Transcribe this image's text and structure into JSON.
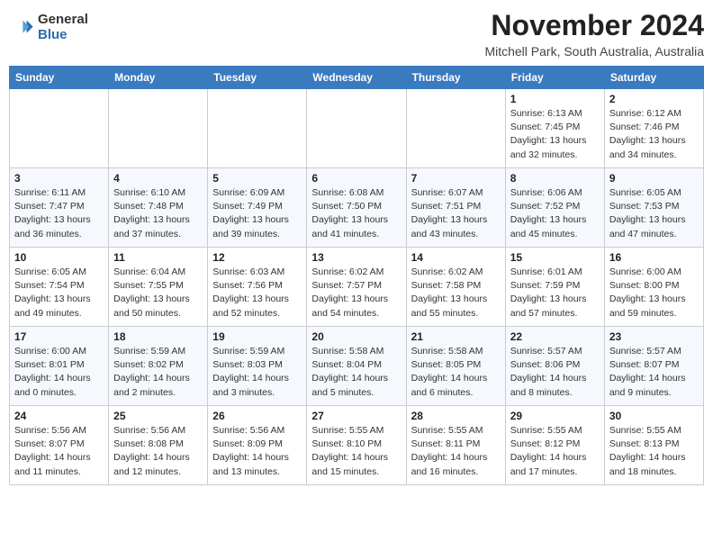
{
  "header": {
    "logo_general": "General",
    "logo_blue": "Blue",
    "month_title": "November 2024",
    "location": "Mitchell Park, South Australia, Australia"
  },
  "columns": [
    "Sunday",
    "Monday",
    "Tuesday",
    "Wednesday",
    "Thursday",
    "Friday",
    "Saturday"
  ],
  "weeks": [
    {
      "days": [
        {
          "num": "",
          "info": ""
        },
        {
          "num": "",
          "info": ""
        },
        {
          "num": "",
          "info": ""
        },
        {
          "num": "",
          "info": ""
        },
        {
          "num": "",
          "info": ""
        },
        {
          "num": "1",
          "info": "Sunrise: 6:13 AM\nSunset: 7:45 PM\nDaylight: 13 hours\nand 32 minutes."
        },
        {
          "num": "2",
          "info": "Sunrise: 6:12 AM\nSunset: 7:46 PM\nDaylight: 13 hours\nand 34 minutes."
        }
      ]
    },
    {
      "days": [
        {
          "num": "3",
          "info": "Sunrise: 6:11 AM\nSunset: 7:47 PM\nDaylight: 13 hours\nand 36 minutes."
        },
        {
          "num": "4",
          "info": "Sunrise: 6:10 AM\nSunset: 7:48 PM\nDaylight: 13 hours\nand 37 minutes."
        },
        {
          "num": "5",
          "info": "Sunrise: 6:09 AM\nSunset: 7:49 PM\nDaylight: 13 hours\nand 39 minutes."
        },
        {
          "num": "6",
          "info": "Sunrise: 6:08 AM\nSunset: 7:50 PM\nDaylight: 13 hours\nand 41 minutes."
        },
        {
          "num": "7",
          "info": "Sunrise: 6:07 AM\nSunset: 7:51 PM\nDaylight: 13 hours\nand 43 minutes."
        },
        {
          "num": "8",
          "info": "Sunrise: 6:06 AM\nSunset: 7:52 PM\nDaylight: 13 hours\nand 45 minutes."
        },
        {
          "num": "9",
          "info": "Sunrise: 6:05 AM\nSunset: 7:53 PM\nDaylight: 13 hours\nand 47 minutes."
        }
      ]
    },
    {
      "days": [
        {
          "num": "10",
          "info": "Sunrise: 6:05 AM\nSunset: 7:54 PM\nDaylight: 13 hours\nand 49 minutes."
        },
        {
          "num": "11",
          "info": "Sunrise: 6:04 AM\nSunset: 7:55 PM\nDaylight: 13 hours\nand 50 minutes."
        },
        {
          "num": "12",
          "info": "Sunrise: 6:03 AM\nSunset: 7:56 PM\nDaylight: 13 hours\nand 52 minutes."
        },
        {
          "num": "13",
          "info": "Sunrise: 6:02 AM\nSunset: 7:57 PM\nDaylight: 13 hours\nand 54 minutes."
        },
        {
          "num": "14",
          "info": "Sunrise: 6:02 AM\nSunset: 7:58 PM\nDaylight: 13 hours\nand 55 minutes."
        },
        {
          "num": "15",
          "info": "Sunrise: 6:01 AM\nSunset: 7:59 PM\nDaylight: 13 hours\nand 57 minutes."
        },
        {
          "num": "16",
          "info": "Sunrise: 6:00 AM\nSunset: 8:00 PM\nDaylight: 13 hours\nand 59 minutes."
        }
      ]
    },
    {
      "days": [
        {
          "num": "17",
          "info": "Sunrise: 6:00 AM\nSunset: 8:01 PM\nDaylight: 14 hours\nand 0 minutes."
        },
        {
          "num": "18",
          "info": "Sunrise: 5:59 AM\nSunset: 8:02 PM\nDaylight: 14 hours\nand 2 minutes."
        },
        {
          "num": "19",
          "info": "Sunrise: 5:59 AM\nSunset: 8:03 PM\nDaylight: 14 hours\nand 3 minutes."
        },
        {
          "num": "20",
          "info": "Sunrise: 5:58 AM\nSunset: 8:04 PM\nDaylight: 14 hours\nand 5 minutes."
        },
        {
          "num": "21",
          "info": "Sunrise: 5:58 AM\nSunset: 8:05 PM\nDaylight: 14 hours\nand 6 minutes."
        },
        {
          "num": "22",
          "info": "Sunrise: 5:57 AM\nSunset: 8:06 PM\nDaylight: 14 hours\nand 8 minutes."
        },
        {
          "num": "23",
          "info": "Sunrise: 5:57 AM\nSunset: 8:07 PM\nDaylight: 14 hours\nand 9 minutes."
        }
      ]
    },
    {
      "days": [
        {
          "num": "24",
          "info": "Sunrise: 5:56 AM\nSunset: 8:07 PM\nDaylight: 14 hours\nand 11 minutes."
        },
        {
          "num": "25",
          "info": "Sunrise: 5:56 AM\nSunset: 8:08 PM\nDaylight: 14 hours\nand 12 minutes."
        },
        {
          "num": "26",
          "info": "Sunrise: 5:56 AM\nSunset: 8:09 PM\nDaylight: 14 hours\nand 13 minutes."
        },
        {
          "num": "27",
          "info": "Sunrise: 5:55 AM\nSunset: 8:10 PM\nDaylight: 14 hours\nand 15 minutes."
        },
        {
          "num": "28",
          "info": "Sunrise: 5:55 AM\nSunset: 8:11 PM\nDaylight: 14 hours\nand 16 minutes."
        },
        {
          "num": "29",
          "info": "Sunrise: 5:55 AM\nSunset: 8:12 PM\nDaylight: 14 hours\nand 17 minutes."
        },
        {
          "num": "30",
          "info": "Sunrise: 5:55 AM\nSunset: 8:13 PM\nDaylight: 14 hours\nand 18 minutes."
        }
      ]
    }
  ]
}
